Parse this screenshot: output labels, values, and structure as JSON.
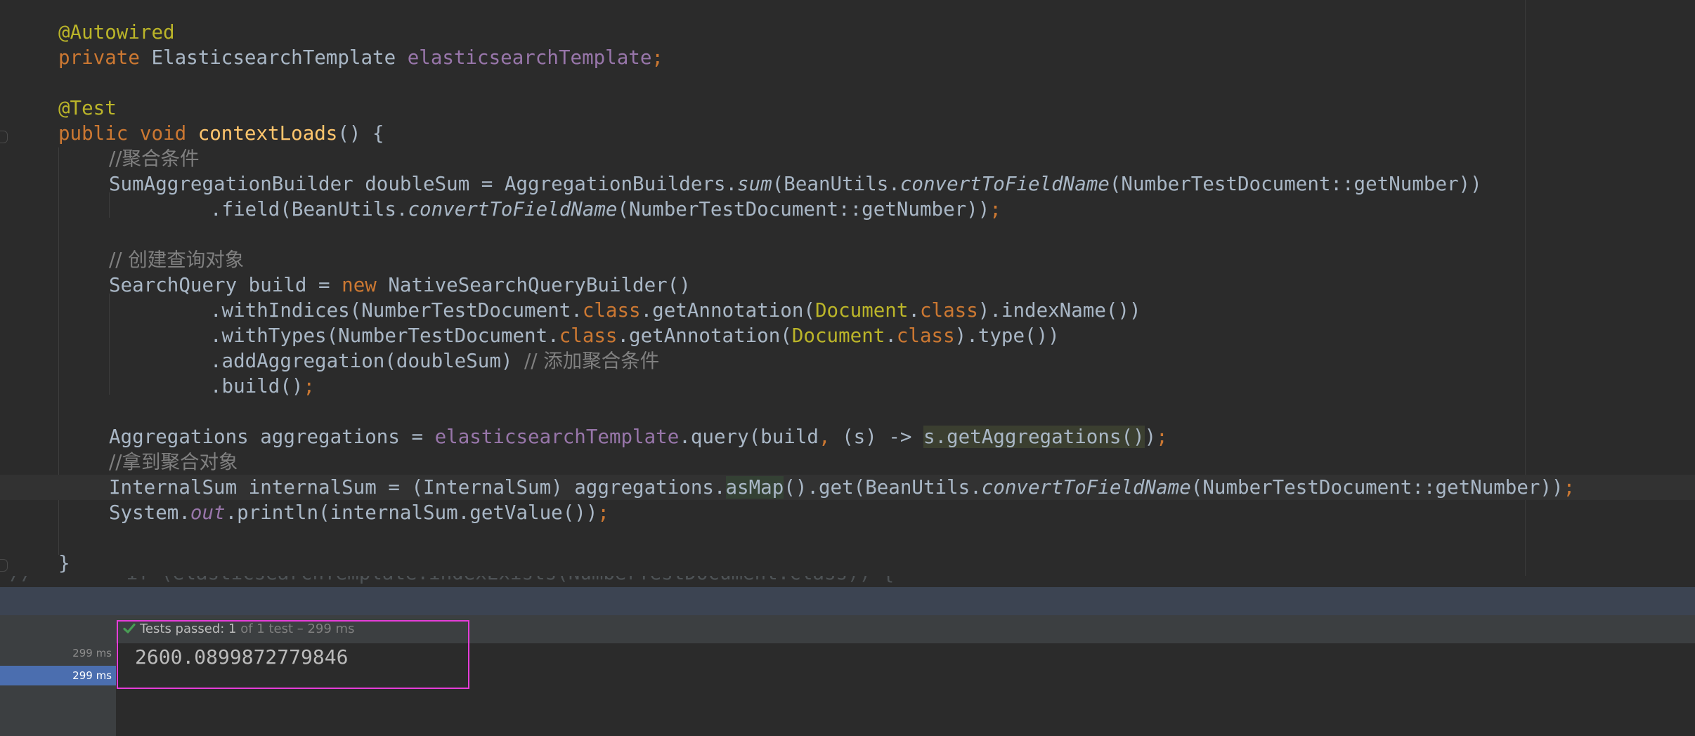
{
  "code": {
    "line_autowired": "@Autowired",
    "kw_private": "private",
    "type_template": " ElasticsearchTemplate ",
    "fld_template": "elasticsearchTemplate",
    "semi": ";",
    "ann_test": "@Test",
    "kw_public": "public",
    "kw_void": " void ",
    "mth_contextloads": "contextLoads",
    "brace_open": "() {",
    "cmt_agg_cond": "//聚合条件",
    "l6_a": "SumAggregationBuilder doubleSum = AggregationBuilders.",
    "l6_sum": "sum",
    "l6_b": "(BeanUtils.",
    "l6_convert": "convertToFieldName",
    "l6_c": "(NumberTestDocument::getNumber))",
    "l7_a": ".field(BeanUtils.",
    "l7_convert": "convertToFieldName",
    "l7_b": "(NumberTestDocument::getNumber))",
    "l7_semi": ";",
    "cmt_create_query": "// 创建查询对象",
    "l9_a": "SearchQuery build = ",
    "kw_new": "new",
    "l9_b": " NativeSearchQueryBuilder()",
    "l10_a": ".withIndices(NumberTestDocument.",
    "kw_class": "class",
    "l10_b": ".getAnnotation(",
    "ann_document": "Document",
    "l10_c": ".",
    "l10_d": ").indexName())",
    "l11_a": ".withTypes(NumberTestDocument.",
    "l11_b": ").type())",
    "l12_a": ".addAggregation(doubleSum) ",
    "cmt_add_agg": "// 添加聚合条件",
    "l13_a": ".build()",
    "l15_a": "Aggregations aggregations = ",
    "l15_fld": "elasticsearchTemplate",
    "l15_b": ".query(build",
    "l15_comma": ",",
    "l15_c": " (s) -> ",
    "l15_hl": "s.getAggregations()",
    "l15_d": ")",
    "cmt_get_agg": "//拿到聚合对象",
    "l17_a": "InternalSum internalSum = (InternalSum) aggregations.",
    "l17_asmap": "asMap",
    "l17_b": "().get(BeanUtils.",
    "l17_convert": "convertToFieldName",
    "l17_c": "(NumberTestDocument::getNumber))",
    "l18_a": "System.",
    "l18_out": "out",
    "l18_b": ".println(internalSum.getValue())",
    "brace_close": "}",
    "cutoff_line": "//        if (elasticsearchTemplate.indexExists(NumberTestDocument.class)) {"
  },
  "runner": {
    "status_main": "Tests passed: ",
    "status_count": "1",
    "status_detail": " of 1 test – 299 ms",
    "times": [
      "299 ms",
      "299 ms"
    ],
    "output_value": "2600.0899872779846"
  },
  "colors": {
    "editor_bg": "#2b2b2b",
    "keyword": "#cc7832",
    "annotation": "#bbb529",
    "field": "#9876aa",
    "method": "#ffc66d",
    "comment": "#808080",
    "default": "#a9b7c6",
    "pass_green": "#499c54",
    "highlight_box": "#e53dd8",
    "selection": "#4b6eaf"
  }
}
